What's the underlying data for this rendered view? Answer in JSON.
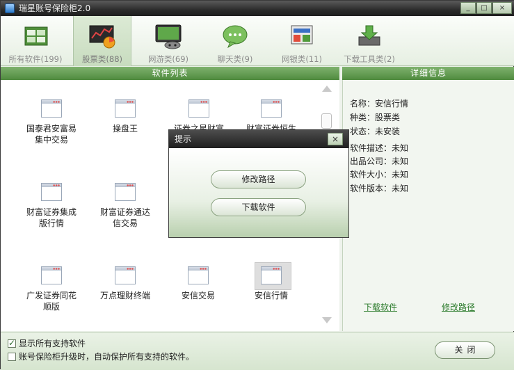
{
  "window": {
    "title": "瑞星账号保险柜2.0",
    "minimize": "_",
    "maximize": "□",
    "close": "×"
  },
  "toolbar": [
    {
      "label": "所有软件(199)",
      "icon": "all-software-icon"
    },
    {
      "label": "股票类(88)",
      "icon": "stock-chart-icon"
    },
    {
      "label": "网游类(69)",
      "icon": "game-console-icon"
    },
    {
      "label": "聊天类(9)",
      "icon": "chat-bubble-icon"
    },
    {
      "label": "网银类(11)",
      "icon": "online-bank-icon"
    },
    {
      "label": "下载工具类(2)",
      "icon": "download-tool-icon"
    }
  ],
  "list_panel": {
    "header": "软件列表"
  },
  "detail_panel": {
    "header": "详细信息"
  },
  "software_items": [
    {
      "label1": "国泰君安富易",
      "label2": "集中交易"
    },
    {
      "label1": "操盘王",
      "label2": ""
    },
    {
      "label1": "证券之星财富",
      "label2": ""
    },
    {
      "label1": "财富证券恒生",
      "label2": ""
    },
    {
      "label1": "财富证券集成",
      "label2": "版行情"
    },
    {
      "label1": "财富证券通达",
      "label2": "信交易"
    },
    {
      "label1": "广发证券同花",
      "label2": "顺版"
    },
    {
      "label1": "万点理财终端",
      "label2": ""
    },
    {
      "label1": "安信交易",
      "label2": ""
    },
    {
      "label1": "安信行情",
      "label2": ""
    }
  ],
  "details": {
    "name": "名称：安信行情",
    "category": "种类：股票类",
    "status": "状态：未安装",
    "description": "软件描述：未知",
    "publisher": "出品公司：未知",
    "size": "软件大小：未知",
    "version": "软件版本：未知",
    "download_link": "下载软件",
    "modify_link": "修改路径"
  },
  "footer": {
    "show_all": "显示所有支持软件",
    "auto_protect": "账号保险柜升级时，自动保护所有支持的软件。",
    "close_button": "关闭"
  },
  "dialog": {
    "title": "提示",
    "close": "×",
    "modify_path": "修改路径",
    "download": "下载软件"
  }
}
